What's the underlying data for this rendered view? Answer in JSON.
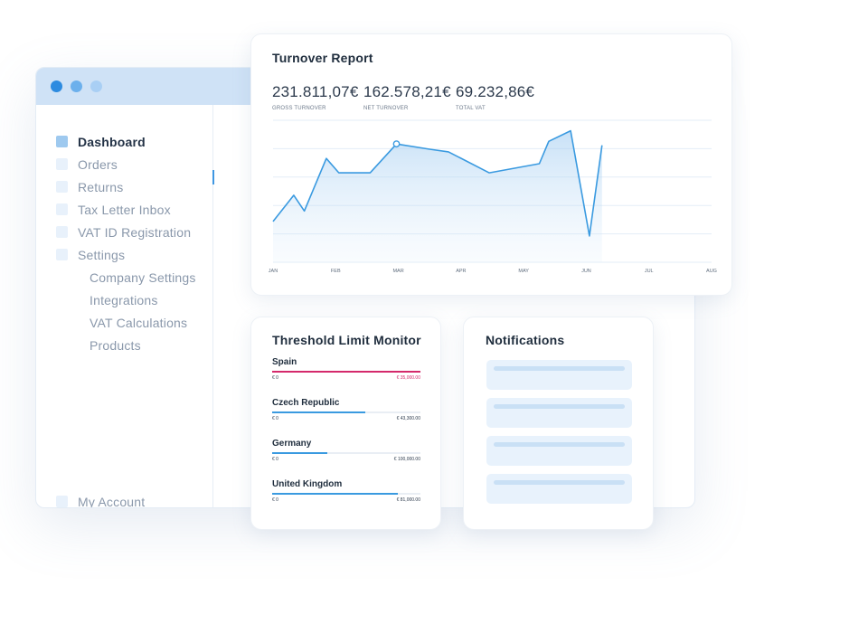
{
  "colors": {
    "accent": "#3a9ae0",
    "danger": "#d4296b",
    "titlebar": "#cfe2f6"
  },
  "sidebar": {
    "items": [
      {
        "label": "Dashboard"
      },
      {
        "label": "Orders"
      },
      {
        "label": "Returns"
      },
      {
        "label": "Tax Letter Inbox"
      },
      {
        "label": "VAT ID Registration"
      },
      {
        "label": "Settings"
      },
      {
        "label": "Company Settings"
      },
      {
        "label": "Integrations"
      },
      {
        "label": "VAT Calculations"
      },
      {
        "label": "Products"
      }
    ],
    "account_label": "My Account"
  },
  "turnover": {
    "title": "Turnover Report",
    "metrics": [
      {
        "value": "231.811,07€",
        "label": "GROSS TURNOVER"
      },
      {
        "value": "162.578,21€",
        "label": "NET TURNOVER"
      },
      {
        "value": "69.232,86€",
        "label": "TOTAL VAT"
      }
    ]
  },
  "chart_data": {
    "type": "area",
    "categories": [
      "JAN",
      "FEB",
      "MAR",
      "APR",
      "MAY",
      "JUN",
      "JUL",
      "AUG"
    ],
    "x": [
      0,
      0.33,
      0.5,
      0.85,
      1.05,
      1.55,
      1.97,
      2.5,
      2.8,
      3.45,
      4.25,
      4.4,
      4.75,
      5.05,
      5.25
    ],
    "y": [
      1.55,
      2.55,
      1.95,
      3.95,
      3.4,
      3.4,
      4.5,
      4.3,
      4.2,
      3.4,
      3.75,
      4.6,
      5.0,
      1.0,
      4.45
    ],
    "highlight_index": 6,
    "ylim": [
      0,
      5.4
    ],
    "grid": true,
    "xlabel": "",
    "ylabel": ""
  },
  "threshold": {
    "title": "Threshold Limit Monitor",
    "countries": [
      {
        "name": "Spain",
        "min": "€ 0",
        "max": "€ 35,000.00",
        "progress": 1.0,
        "over": true
      },
      {
        "name": "Czech Republic",
        "min": "€ 0",
        "max": "€ 43,300.00",
        "progress": 0.63,
        "over": false
      },
      {
        "name": "Germany",
        "min": "€ 0",
        "max": "€ 100,000.00",
        "progress": 0.37,
        "over": false
      },
      {
        "name": "United Kingdom",
        "min": "€ 0",
        "max": "€ 81,000.00",
        "progress": 0.85,
        "over": false
      }
    ]
  },
  "notifications": {
    "title": "Notifications",
    "count": 4
  }
}
